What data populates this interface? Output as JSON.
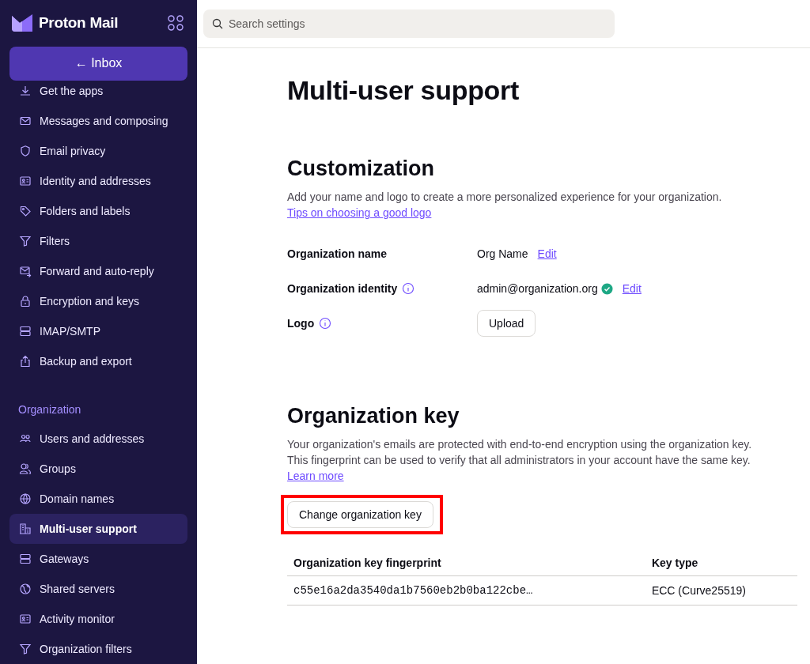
{
  "brand": {
    "name": "Proton Mail"
  },
  "inbox_button": {
    "label": "Inbox",
    "arrow": "←"
  },
  "search": {
    "placeholder": "Search settings"
  },
  "sidebar": {
    "items": [
      {
        "label": "Get the apps",
        "selected": false
      },
      {
        "label": "Messages and composing",
        "selected": false
      },
      {
        "label": "Email privacy",
        "selected": false
      },
      {
        "label": "Identity and addresses",
        "selected": false
      },
      {
        "label": "Folders and labels",
        "selected": false
      },
      {
        "label": "Filters",
        "selected": false
      },
      {
        "label": "Forward and auto-reply",
        "selected": false
      },
      {
        "label": "Encryption and keys",
        "selected": false
      },
      {
        "label": "IMAP/SMTP",
        "selected": false
      },
      {
        "label": "Backup and export",
        "selected": false
      }
    ],
    "section": {
      "title": "Organization",
      "items": [
        {
          "label": "Users and addresses",
          "selected": false
        },
        {
          "label": "Groups",
          "selected": false
        },
        {
          "label": "Domain names",
          "selected": false
        },
        {
          "label": "Multi-user support",
          "selected": true
        },
        {
          "label": "Gateways",
          "selected": false
        },
        {
          "label": "Shared servers",
          "selected": false
        },
        {
          "label": "Activity monitor",
          "selected": false
        },
        {
          "label": "Organization filters",
          "selected": false
        }
      ]
    }
  },
  "page": {
    "title": "Multi-user support"
  },
  "customization": {
    "title": "Customization",
    "description": "Add your name and logo to create a more personalized experience for your organization.",
    "link": "Tips on choosing a good logo",
    "rows": [
      {
        "kind": "text",
        "label": "Organization name",
        "info": false,
        "value": "Org Name",
        "verified": false,
        "action": "Edit"
      },
      {
        "kind": "text",
        "label": "Organization identity",
        "info": true,
        "value": "admin@organization.org",
        "verified": true,
        "action": "Edit"
      },
      {
        "kind": "upload",
        "label": "Logo",
        "info": true,
        "action": "Upload"
      }
    ]
  },
  "organization_key": {
    "title": "Organization key",
    "description": "Your organization's emails are protected with end-to-end encryption using the organization key. This fingerprint can be used to verify that all administrators in your account have the same key.",
    "link": "Learn more",
    "button": "Change organization key",
    "highlighted": true,
    "table": {
      "columns": [
        "Organization key fingerprint",
        "Key type"
      ],
      "rows": [
        [
          "c55e16a2da3540da1b7560eb2b0ba122cbe…",
          "ECC (Curve25519)"
        ]
      ]
    }
  }
}
